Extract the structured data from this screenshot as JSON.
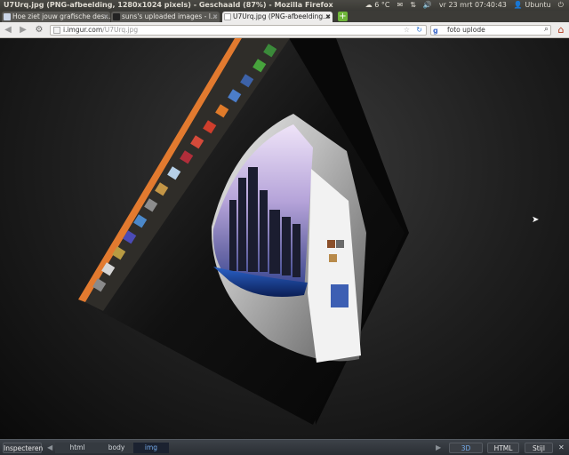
{
  "window": {
    "title": "U7Urq.jpg (PNG-afbeelding, 1280x1024 pixels) - Geschaald (87%) - Mozilla Firefox"
  },
  "panel": {
    "weather": "6 °C",
    "datetime": "vr 23 mrt 07:40:43",
    "user": "Ubuntu"
  },
  "tabs": [
    {
      "label": "Hoe ziet jouw grafische des..."
    },
    {
      "label": "suns's uploaded images - I..."
    },
    {
      "label": "U7Urq.jpg (PNG-afbeelding..."
    }
  ],
  "nav": {
    "url_domain": "i.imgur.com",
    "url_path": "/U7Urq.jpg",
    "search_value": "foto uplode"
  },
  "inspector": {
    "inspect_label": "Inspecteren",
    "crumbs": [
      "html",
      "body",
      "img"
    ],
    "view_3d": "3D",
    "html_label": "HTML",
    "style_label": "Stijl"
  },
  "colors": {
    "launcher_orange": "#e27a2f",
    "panel_dark": "#3c3b37",
    "inspector_bg": "#2f3338",
    "selected_crumb": "#74a9e8"
  }
}
